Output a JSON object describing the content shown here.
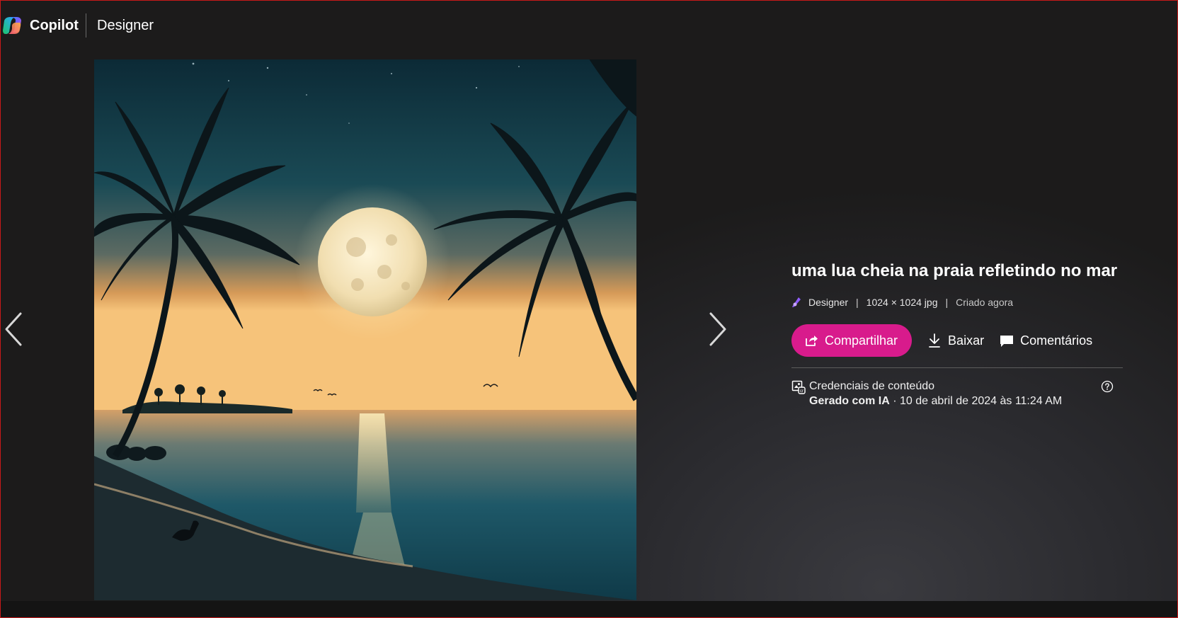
{
  "header": {
    "brand_name": "Copilot",
    "app_name": "Designer"
  },
  "viewer": {
    "prev_icon": "chevron-left-icon",
    "next_icon": "chevron-right-icon",
    "image_subject": "full moon over beach with palm trees"
  },
  "details": {
    "title": "uma lua cheia na praia refletindo no mar",
    "meta": {
      "source": "Designer",
      "dimensions": "1024 × 1024 jpg",
      "created": "Criado agora",
      "separator": "|"
    },
    "actions": {
      "share_label": "Compartilhar",
      "download_label": "Baixar",
      "comments_label": "Comentários"
    },
    "credentials": {
      "label": "Credenciais de conteúdo",
      "generated_label": "Gerado com IA",
      "dot": " · ",
      "date": "10 de abril de 2024 às 11:24 AM"
    }
  },
  "colors": {
    "accent": "#d81b8c",
    "background": "#1c1b1b"
  }
}
